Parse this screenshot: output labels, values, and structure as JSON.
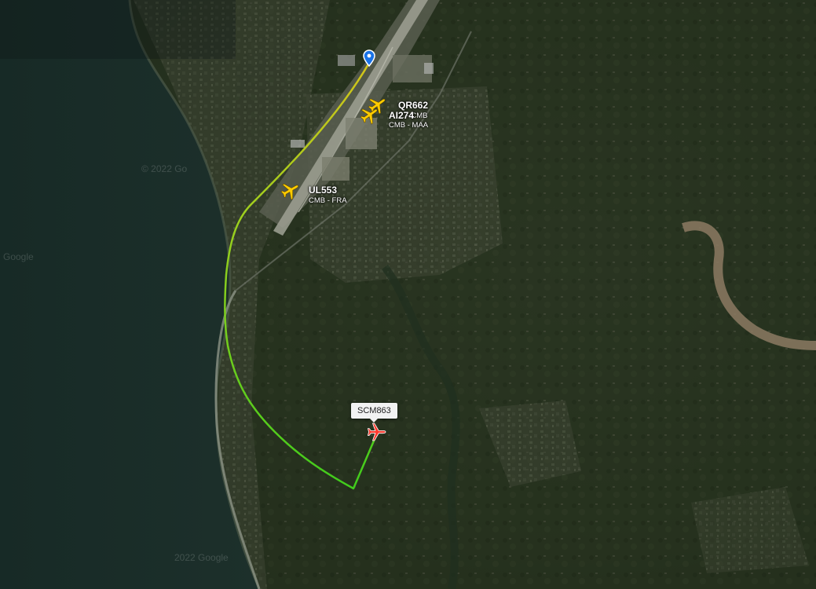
{
  "map": {
    "watermark_copyright": "© 2022 Go",
    "watermark_google": "Google",
    "watermark_bottom": "2022 Google"
  },
  "flights": [
    {
      "callsign": "QR662",
      "route": "... - CMB",
      "status": "ground"
    },
    {
      "callsign": "AI274",
      "route": "CMB - MAA",
      "status": "ground"
    },
    {
      "callsign": "UL553",
      "route": "CMB - FRA",
      "status": "ground"
    },
    {
      "callsign": "SCM863",
      "route": "",
      "status": "selected"
    }
  ],
  "colors": {
    "aircraft": "#ffcc00",
    "selected_aircraft": "#ff3b30",
    "track_start": "#c8c81a",
    "track_end": "#48d01e",
    "marker": "#1a73e8"
  },
  "icons": {
    "aircraft": "airplane-icon",
    "selected": "selected-airplane-icon",
    "airport_marker": "location-pin-icon"
  }
}
